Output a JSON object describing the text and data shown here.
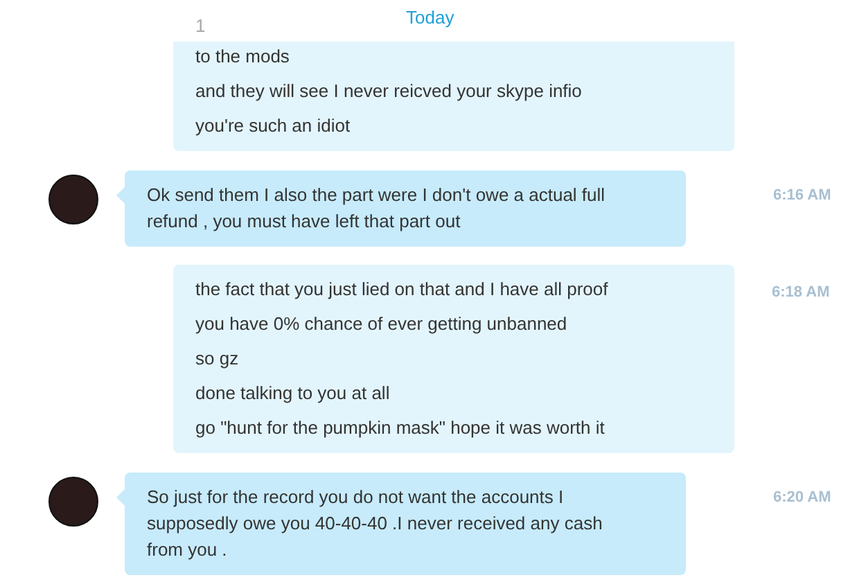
{
  "date_divider": "Today",
  "messages": [
    {
      "kind": "outgoing",
      "faded_lines": [
        "1"
      ],
      "lines": [
        "to the mods",
        "and they will see I never reicved your skype infio",
        "you're such an idiot"
      ]
    },
    {
      "kind": "incoming",
      "time": "6:16 AM",
      "text": "Ok send them I also the part were I don't owe a actual full refund , you must have left that part out"
    },
    {
      "kind": "outgoing",
      "time": "6:18 AM",
      "lines": [
        "the fact that you just lied on that and I have all proof",
        "you have 0% chance of ever getting unbanned",
        "so gz",
        "done talking to you at all",
        "go \"hunt for the pumpkin mask\" hope it was worth it"
      ]
    },
    {
      "kind": "incoming",
      "time": "6:20 AM",
      "text": "So just for the record you do not want the accounts I supposedly owe you 40-40-40 .I never received any cash from you ."
    }
  ]
}
